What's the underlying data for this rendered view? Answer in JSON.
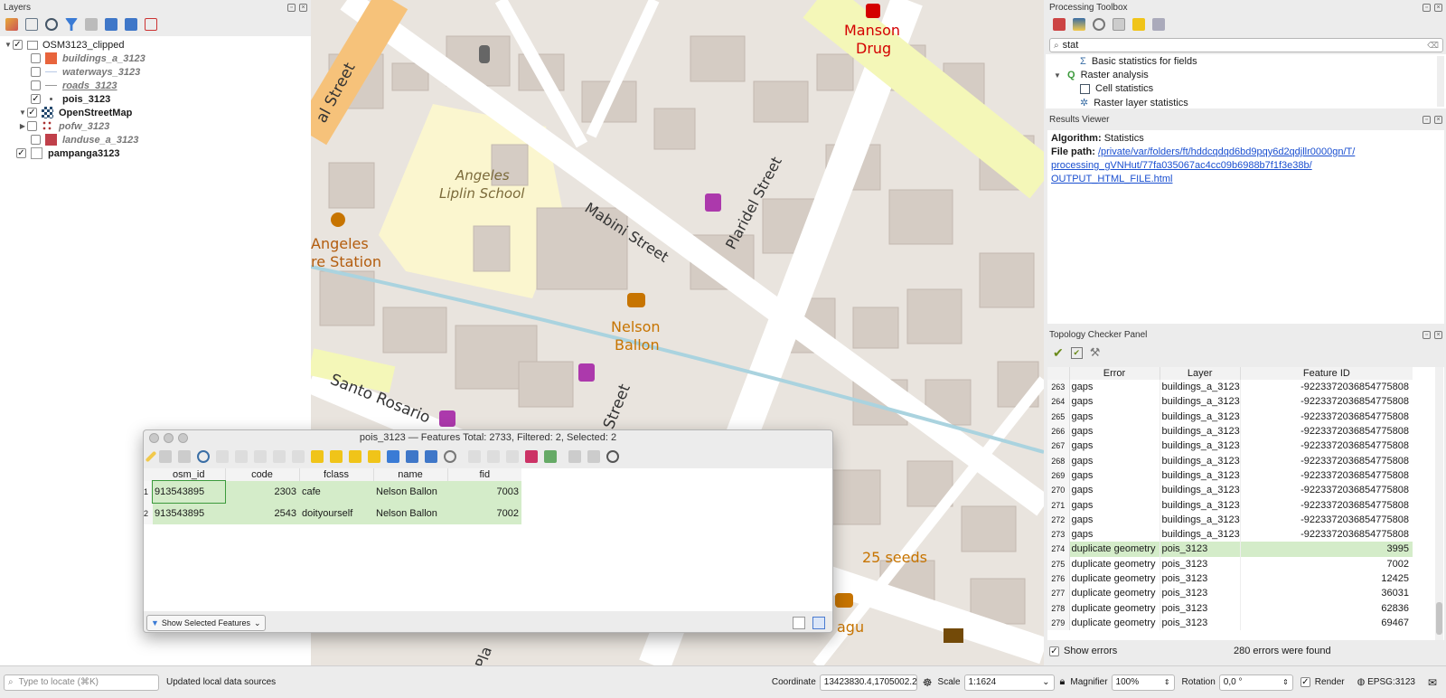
{
  "layers_panel": {
    "title": "Layers",
    "items": [
      {
        "label": "OSM3123_clipped",
        "checked": true,
        "expanded": true,
        "kind": "group"
      },
      {
        "label": "buildings_a_3123",
        "checked": false,
        "swatch": "#e8643c"
      },
      {
        "label": "waterways_3123",
        "checked": false,
        "swatch": "line"
      },
      {
        "label": "roads_3123",
        "checked": false,
        "swatch": "line"
      },
      {
        "label": "pois_3123",
        "checked": true,
        "swatch": "dot"
      },
      {
        "label": "OpenStreetMap",
        "checked": true,
        "expanded": true
      },
      {
        "label": "pofw_3123",
        "checked": false,
        "swatch": "dots"
      },
      {
        "label": "landuse_a_3123",
        "checked": false,
        "swatch": "#c0404a"
      },
      {
        "label": "pampanga3123",
        "checked": true
      }
    ]
  },
  "map": {
    "labels": {
      "manson": "Manson",
      "drug": "Drug",
      "mabini": "Mabini Street",
      "plaridel": "Plaridel Street",
      "angeles_liplin_1": "Angeles",
      "angeles_liplin_2": "Liplin School",
      "angeles_station_1": "Angeles",
      "angeles_station_2": "re Station",
      "nelson_1": "Nelson",
      "nelson_2": "Ballon",
      "santo_rosario": "Santo Rosario",
      "street_left": "al Street",
      "street_mid": "Street",
      "seeds": "25 seeds",
      "agu": "agu",
      "pla": "Pla"
    }
  },
  "toolbox": {
    "title": "Processing Toolbox",
    "search_value": "stat",
    "items": [
      {
        "label": "Basic statistics for fields",
        "indent": 2
      },
      {
        "label": "Raster analysis",
        "indent": 1
      },
      {
        "label": "Cell statistics",
        "indent": 2
      },
      {
        "label": "Raster layer statistics",
        "indent": 2
      }
    ]
  },
  "results": {
    "title": "Results Viewer",
    "algorithm_label": "Algorithm",
    "algorithm_value": "Statistics",
    "filepath_label": "File path",
    "filepath_line1": "/private/var/folders/ft/hddcqdqd6bd9pqy6d2qdjllr0000gn/T/",
    "filepath_line2": "processing_gVNHut/77fa035067ac4cc09b6988b7f1f3e38b/",
    "filepath_line3": "OUTPUT_HTML_FILE.html"
  },
  "topology": {
    "title": "Topology Checker Panel",
    "columns": [
      "Error",
      "Layer",
      "Feature ID"
    ],
    "rows": [
      {
        "n": "263",
        "error": "gaps",
        "layer": "buildings_a_3123",
        "fid": "-9223372036854775808"
      },
      {
        "n": "264",
        "error": "gaps",
        "layer": "buildings_a_3123",
        "fid": "-9223372036854775808"
      },
      {
        "n": "265",
        "error": "gaps",
        "layer": "buildings_a_3123",
        "fid": "-9223372036854775808"
      },
      {
        "n": "266",
        "error": "gaps",
        "layer": "buildings_a_3123",
        "fid": "-9223372036854775808"
      },
      {
        "n": "267",
        "error": "gaps",
        "layer": "buildings_a_3123",
        "fid": "-9223372036854775808"
      },
      {
        "n": "268",
        "error": "gaps",
        "layer": "buildings_a_3123",
        "fid": "-9223372036854775808"
      },
      {
        "n": "269",
        "error": "gaps",
        "layer": "buildings_a_3123",
        "fid": "-9223372036854775808"
      },
      {
        "n": "270",
        "error": "gaps",
        "layer": "buildings_a_3123",
        "fid": "-9223372036854775808"
      },
      {
        "n": "271",
        "error": "gaps",
        "layer": "buildings_a_3123",
        "fid": "-9223372036854775808"
      },
      {
        "n": "272",
        "error": "gaps",
        "layer": "buildings_a_3123",
        "fid": "-9223372036854775808"
      },
      {
        "n": "273",
        "error": "gaps",
        "layer": "buildings_a_3123",
        "fid": "-9223372036854775808"
      },
      {
        "n": "274",
        "error": "duplicate geometry",
        "layer": "pois_3123",
        "fid": "3995",
        "selected": true
      },
      {
        "n": "275",
        "error": "duplicate geometry",
        "layer": "pois_3123",
        "fid": "7002"
      },
      {
        "n": "276",
        "error": "duplicate geometry",
        "layer": "pois_3123",
        "fid": "12425"
      },
      {
        "n": "277",
        "error": "duplicate geometry",
        "layer": "pois_3123",
        "fid": "36031"
      },
      {
        "n": "278",
        "error": "duplicate geometry",
        "layer": "pois_3123",
        "fid": "62836"
      },
      {
        "n": "279",
        "error": "duplicate geometry",
        "layer": "pois_3123",
        "fid": "69467"
      }
    ],
    "show_errors_label": "Show errors",
    "summary": "280 errors were found"
  },
  "attribute_table": {
    "title": "pois_3123 — Features Total: 2733, Filtered: 2, Selected: 2",
    "columns": [
      "osm_id",
      "code",
      "fclass",
      "name",
      "fid"
    ],
    "rows": [
      {
        "n": "1",
        "osm_id": "913543895",
        "code": "2303",
        "fclass": "cafe",
        "name": "Nelson Ballon",
        "fid": "7003"
      },
      {
        "n": "2",
        "osm_id": "913543895",
        "code": "2543",
        "fclass": "doityourself",
        "name": "Nelson Ballon",
        "fid": "7002"
      }
    ],
    "filter_button": "Show Selected Features"
  },
  "statusbar": {
    "locate_placeholder": "Type to locate (⌘K)",
    "message": "Updated local data sources",
    "coordinate_label": "Coordinate",
    "coordinate_value": "13423830.4,1705002.2",
    "scale_label": "Scale",
    "scale_value": "1:1624",
    "magnifier_label": "Magnifier",
    "magnifier_value": "100%",
    "rotation_label": "Rotation",
    "rotation_value": "0,0 °",
    "render_label": "Render",
    "crs": "EPSG:3123"
  }
}
